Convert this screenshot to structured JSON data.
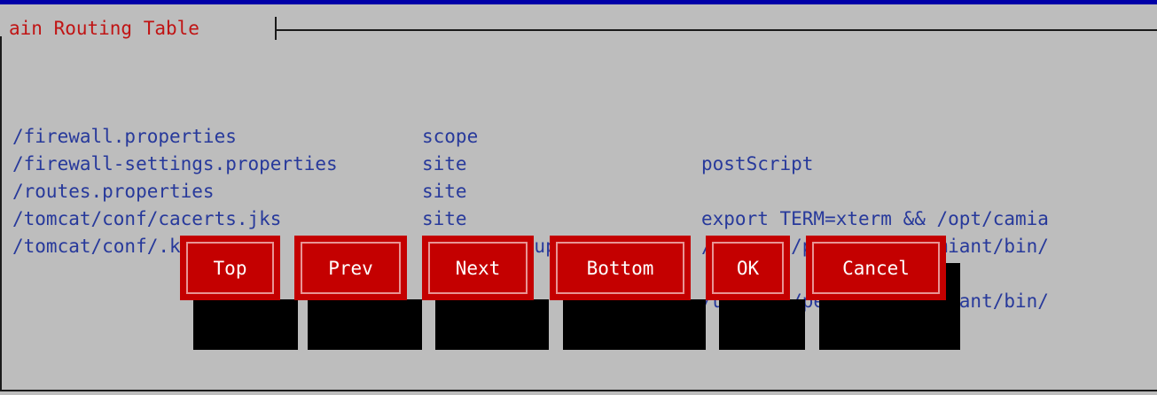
{
  "window": {
    "title": "ain Routing Table"
  },
  "table": {
    "headers": [
      "",
      "scope",
      "postScript"
    ],
    "rows": [
      [
        "/firewall.properties",
        "site",
        ""
      ],
      [
        "/firewall-settings.properties",
        "site",
        "export TERM=xterm && /opt/camia"
      ],
      [
        "/routes.properties",
        "site",
        "/usr/bin/perl /opt/camiant/bin/"
      ],
      [
        "/tomcat/conf/cacerts.jks",
        "clusterGroup",
        ""
      ],
      [
        "/tomcat/conf/.keystore",
        "cluster",
        "/usr/bin/perl /opt/camiant/bin/"
      ]
    ]
  },
  "buttons": {
    "top": "Top",
    "prev": "Prev",
    "next": "Next",
    "bottom": "Bottom",
    "ok": "OK",
    "cancel": "Cancel"
  },
  "colors": {
    "background": "#bdbdbd",
    "text": "#27399b",
    "title": "#c01414",
    "button": "#c40000",
    "button_border": "#e89494",
    "shadow": "#000000",
    "top_strip": "#0000a8"
  }
}
